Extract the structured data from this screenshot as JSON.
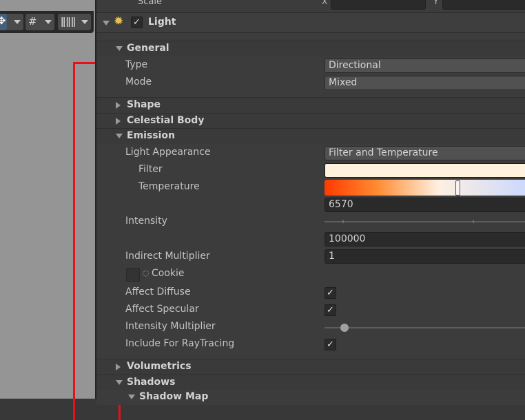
{
  "scene_toolbar": {
    "gizmo_icon": "move-gizmo-icon",
    "grid_icon": "grid-snap-icon",
    "ruler_icon": "ruler-increment-icon"
  },
  "top_row": {
    "label": "Scale",
    "field_x_axis": "X",
    "field_y_axis": "Y"
  },
  "component": {
    "title": "Light",
    "enabled": true,
    "icon": "light-component-icon"
  },
  "sections": {
    "general": "General",
    "shape": "Shape",
    "celestial_body": "Celestial Body",
    "emission": "Emission",
    "volumetrics": "Volumetrics",
    "shadows": "Shadows",
    "shadow_map": "Shadow Map"
  },
  "general": {
    "type_label": "Type",
    "type_value": "Directional",
    "mode_label": "Mode",
    "mode_value": "Mixed"
  },
  "emission": {
    "light_appearance_label": "Light Appearance",
    "light_appearance_value": "Filter and Temperature",
    "filter_label": "Filter",
    "filter_color": "#fff3dd",
    "temperature_label": "Temperature",
    "temperature_value": "6570",
    "temperature_slider_fraction": 0.59,
    "intensity_label": "Intensity",
    "intensity_value": "100000",
    "indirect_multiplier_label": "Indirect Multiplier",
    "indirect_multiplier_value": "1",
    "cookie_label": "Cookie",
    "cookie_icon": "cookie-texture-icon",
    "affect_diffuse_label": "Affect Diffuse",
    "affect_diffuse": true,
    "affect_specular_label": "Affect Specular",
    "affect_specular": true,
    "intensity_multiplier_label": "Intensity Multiplier",
    "include_raytracing_label": "Include For RayTracing",
    "include_raytracing": true
  },
  "colors": {
    "highlight_rect": "#e8101a",
    "temperature_gradient": [
      "#ff3a00",
      "#ff8a30",
      "#fff0e0",
      "#c8d8ff"
    ]
  }
}
